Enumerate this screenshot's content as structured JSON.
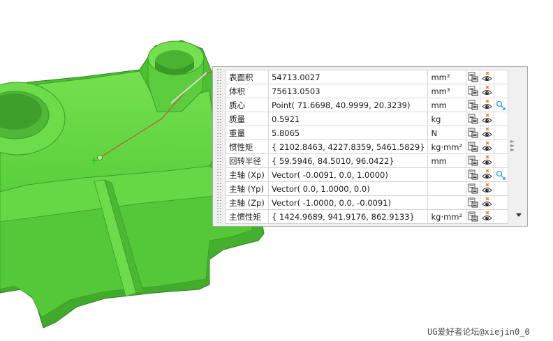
{
  "properties": [
    {
      "name": "表面积",
      "value": "54713.0027",
      "unit": "mm²",
      "has_vector_icon": false
    },
    {
      "name": "体积",
      "value": "75613.0503",
      "unit": "mm³",
      "has_vector_icon": false
    },
    {
      "name": "质心",
      "value": "Point( 71.6698, 40.9999, 20.3239)",
      "unit": "mm",
      "has_vector_icon": true
    },
    {
      "name": "质量",
      "value": "0.5921",
      "unit": "kg",
      "has_vector_icon": false
    },
    {
      "name": "重量",
      "value": "5.8065",
      "unit": "N",
      "has_vector_icon": false
    },
    {
      "name": "惯性矩",
      "value": "{ 2102.8463, 4227.8359, 5461.5829}",
      "unit": "kg·mm²",
      "has_vector_icon": false
    },
    {
      "name": "回转半径",
      "value": "{ 59.5946, 84.5010, 96.0422}",
      "unit": "mm",
      "has_vector_icon": false
    },
    {
      "name": "主轴 (Xp)",
      "value": "Vector( -0.0091, 0.0, 1.0000)",
      "unit": "",
      "has_vector_icon": true
    },
    {
      "name": "主轴 (Yp)",
      "value": "Vector( 0.0, 1.0000, 0.0)",
      "unit": "",
      "has_vector_icon": false
    },
    {
      "name": "主轴 (Zp)",
      "value": "Vector( -1.0000, 0.0, -0.0091)",
      "unit": "",
      "has_vector_icon": false
    },
    {
      "name": "主惯性矩",
      "value": "{ 1424.9689, 941.9176, 862.9133}",
      "unit": "kg·mm²",
      "has_vector_icon": false
    }
  ],
  "watermark": "UG爱好者论坛@xiejin0_0",
  "colors": {
    "part_green": "#5ed03f",
    "part_dark": "#3c9a29",
    "leader_line": "#b4602e",
    "vector_icon": "#2a9fd8"
  },
  "icons": {
    "copy": "copy-to-clipboard-icon",
    "visibility": "show-hide-icon",
    "vector": "vector-display-icon"
  }
}
